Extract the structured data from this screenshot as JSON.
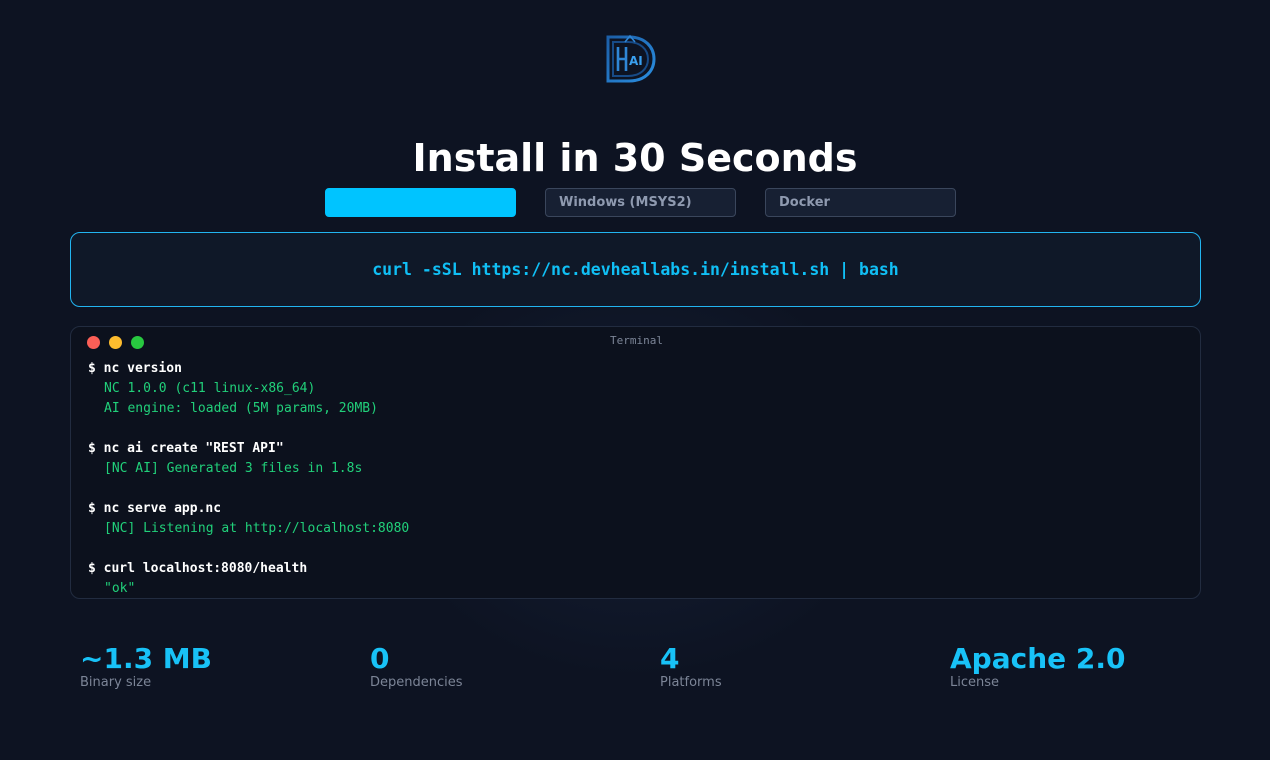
{
  "page": {
    "title": "Install in 30 Seconds"
  },
  "logo": {
    "icon": "dh-ai-logo-icon",
    "text": "AI"
  },
  "tabs": [
    {
      "label": "",
      "active": true
    },
    {
      "label": "Windows (MSYS2)",
      "active": false
    },
    {
      "label": "Docker",
      "active": false
    }
  ],
  "install": {
    "command": "curl -sSL https://nc.devheallabs.in/install.sh | bash"
  },
  "terminal": {
    "title": "Terminal",
    "lines": [
      {
        "type": "cmd",
        "text": "$ nc version"
      },
      {
        "type": "out",
        "text": "NC 1.0.0 (c11 linux-x86_64)"
      },
      {
        "type": "out",
        "text": "AI engine: loaded (5M params, 20MB)"
      },
      {
        "type": "blank",
        "text": ""
      },
      {
        "type": "cmd",
        "text": "$ nc ai create \"REST API\""
      },
      {
        "type": "out",
        "text": "[NC AI] Generated 3 files in 1.8s"
      },
      {
        "type": "blank",
        "text": ""
      },
      {
        "type": "cmd",
        "text": "$ nc serve app.nc"
      },
      {
        "type": "out",
        "text": "[NC] Listening at http://localhost:8080"
      },
      {
        "type": "blank",
        "text": ""
      },
      {
        "type": "cmd",
        "text": "$ curl localhost:8080/health"
      },
      {
        "type": "out",
        "text": "\"ok\""
      }
    ]
  },
  "stats": [
    {
      "value": "~1.3 MB",
      "label": "Binary size"
    },
    {
      "value": "0",
      "label": "Dependencies"
    },
    {
      "value": "4",
      "label": "Platforms"
    },
    {
      "value": "Apache 2.0",
      "label": "License"
    }
  ],
  "colors": {
    "background": "#0d1322",
    "accent": "#00c4ff",
    "terminal_output": "#21d07a"
  }
}
